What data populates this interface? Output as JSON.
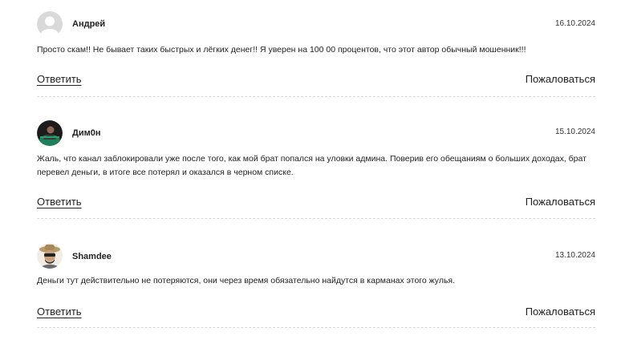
{
  "comments": [
    {
      "author": "Андрей",
      "date": "16.10.2024",
      "text": "Просто скам!! Не бывает таких быстрых и лёгких денег!! Я уверен на 100 00 процентов, что этот автор обычный мошенник!!!",
      "reply_label": "Ответить",
      "report_label": "Пожаловаться",
      "avatar": "default-user-avatar"
    },
    {
      "author": "Дим0н",
      "date": "15.10.2024",
      "text": "Жаль, что канал заблокировали уже после того, как мой брат попался на уловки админа. Поверив его обещаниям о больших доходах, брат перевел деньги, в итоге все потерял и оказался в черном списке.",
      "reply_label": "Ответить",
      "report_label": "Пожаловаться",
      "avatar": "photo-avatar-dark"
    },
    {
      "author": "Shamdee",
      "date": "13.10.2024",
      "text": "Деньги тут действительно не потеряются, они через время обязательно найдутся в карманах этого жулья.",
      "reply_label": "Ответить",
      "report_label": "Пожаловаться",
      "avatar": "photo-avatar-hat-sunglasses"
    }
  ]
}
